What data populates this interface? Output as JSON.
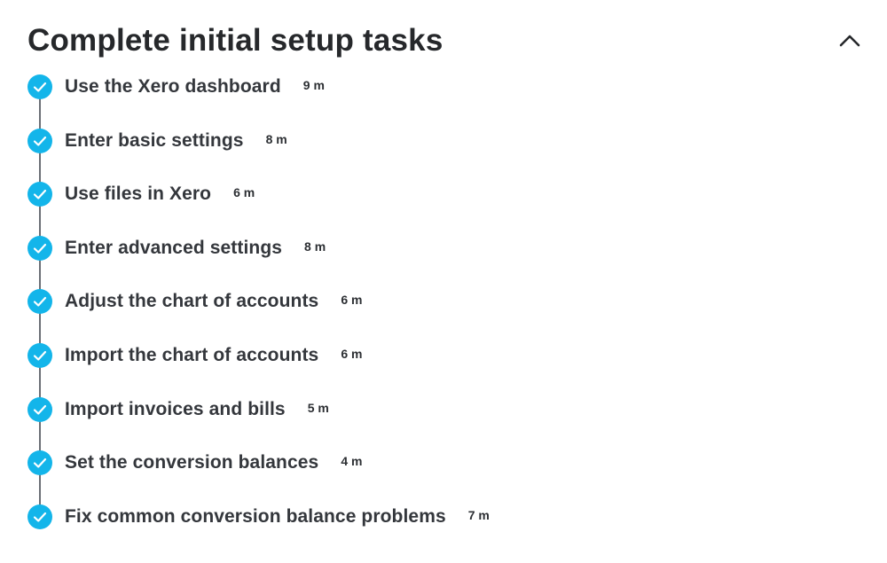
{
  "section": {
    "title": "Complete initial setup tasks",
    "collapse_icon": "chevron-up-icon"
  },
  "colors": {
    "check_fill": "#13b5ea",
    "check_mark": "#ffffff",
    "timeline_line": "#6b6f75"
  },
  "tasks": [
    {
      "title": "Use the Xero dashboard",
      "duration": "9 m",
      "status": "complete",
      "icon": "check-circle-icon"
    },
    {
      "title": "Enter basic settings",
      "duration": "8 m",
      "status": "complete",
      "icon": "check-circle-icon"
    },
    {
      "title": "Use files in Xero",
      "duration": "6 m",
      "status": "complete",
      "icon": "check-circle-icon"
    },
    {
      "title": "Enter advanced settings",
      "duration": "8 m",
      "status": "complete",
      "icon": "check-circle-icon"
    },
    {
      "title": "Adjust the chart of accounts",
      "duration": "6 m",
      "status": "complete",
      "icon": "check-circle-icon"
    },
    {
      "title": "Import the chart of accounts",
      "duration": "6 m",
      "status": "complete",
      "icon": "check-circle-icon"
    },
    {
      "title": "Import invoices and bills",
      "duration": "5 m",
      "status": "complete",
      "icon": "check-circle-icon"
    },
    {
      "title": "Set the conversion balances",
      "duration": "4 m",
      "status": "complete",
      "icon": "check-circle-icon"
    },
    {
      "title": "Fix common conversion balance problems",
      "duration": "7 m",
      "status": "complete",
      "icon": "check-circle-icon"
    }
  ]
}
